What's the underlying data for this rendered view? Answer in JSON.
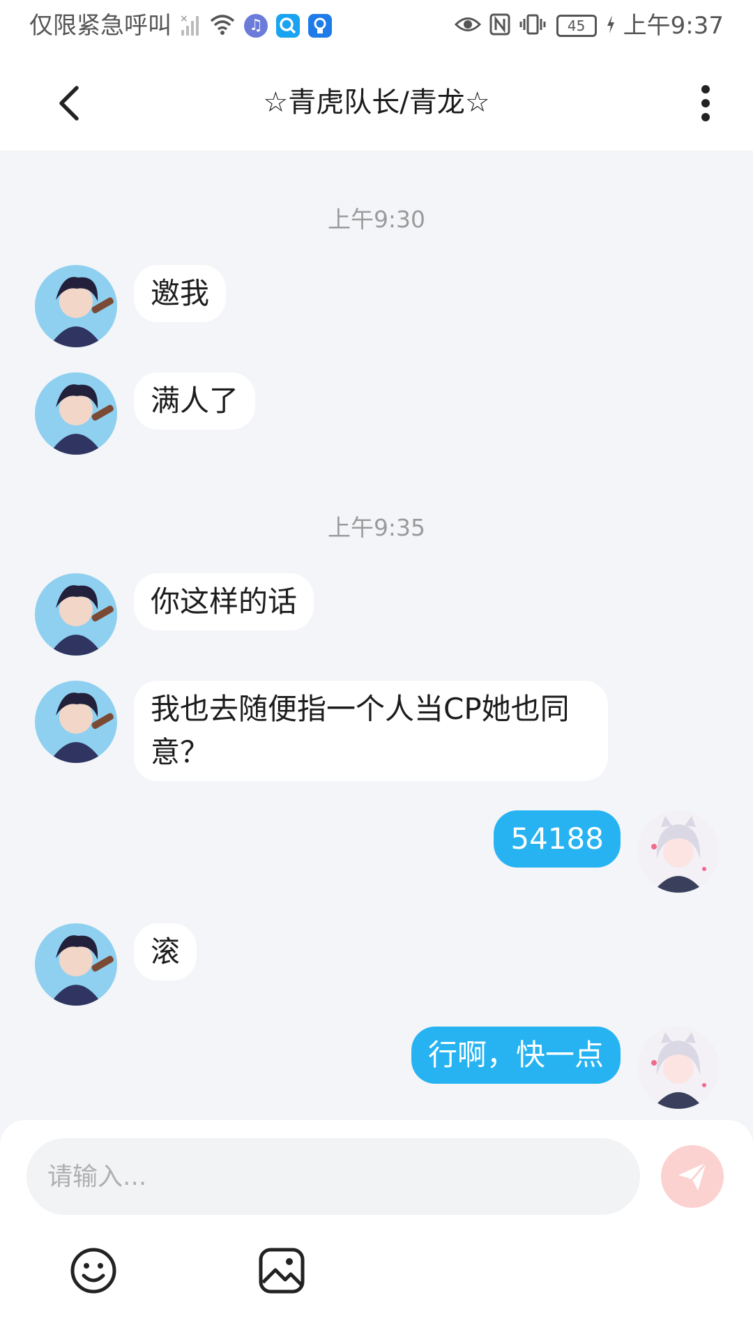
{
  "status_bar": {
    "left_text": "仅限紧急呼叫",
    "battery": "45",
    "time": "上午9:37",
    "icons": [
      "no-signal-icon",
      "wifi-icon",
      "music-app-icon",
      "search-app-icon",
      "bulb-app-icon",
      "eye-icon",
      "nfc-icon",
      "vibrate-icon",
      "battery-icon",
      "charging-icon"
    ]
  },
  "header": {
    "title": "☆青虎队长/青龙☆",
    "icons": [
      "back-chevron-icon",
      "more-vertical-icon"
    ]
  },
  "messages": {
    "timestamps": [
      "上午9:30",
      "上午9:35"
    ],
    "items": [
      {
        "side": "left",
        "text": "邀我"
      },
      {
        "side": "left",
        "text": "满人了"
      },
      {
        "side": "left",
        "text": "你这样的话"
      },
      {
        "side": "left",
        "text": "我也去随便指一个人当CP她也同意？"
      },
      {
        "side": "right",
        "text": "54188"
      },
      {
        "side": "left",
        "text": "滚"
      },
      {
        "side": "right",
        "text": "行啊，快一点"
      }
    ]
  },
  "input": {
    "placeholder": "请输入...",
    "icons": [
      "send-icon",
      "emoji-icon",
      "image-icon"
    ]
  },
  "colors": {
    "outgoing_bubble": "#27b3f2",
    "incoming_bubble": "#ffffff",
    "chat_background": "#f3f5f8",
    "send_button": "#fbd2cf"
  }
}
